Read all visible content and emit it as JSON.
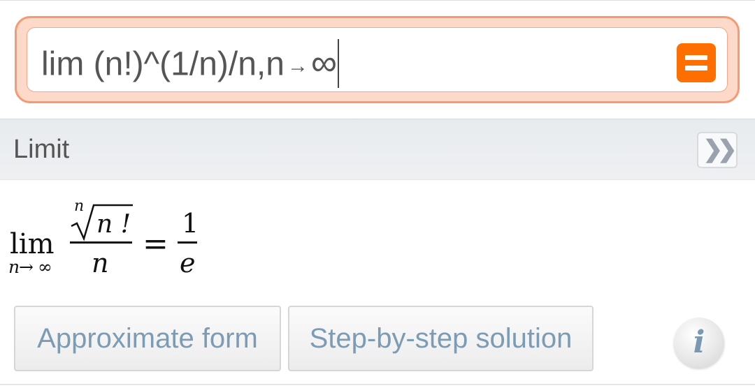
{
  "query": {
    "text": "lim (n!)^(1/n)/n,n",
    "arrow": "→",
    "tail": "∞"
  },
  "pod": {
    "title": "Limit",
    "more_glyph": "❯❯"
  },
  "result": {
    "lim": "lim",
    "sub_var": "n",
    "sub_arrow": "→",
    "sub_inf": "∞",
    "root_index": "n",
    "numerator": "n !",
    "denominator": "n",
    "equals": "=",
    "rhs_num": "1",
    "rhs_den": "e"
  },
  "buttons": {
    "approximate": "Approximate form",
    "steps": "Step-by-step solution",
    "info": "i"
  },
  "colors": {
    "accent": "#ff6f00",
    "input_border": "#f59a72",
    "button_text": "#7b9cb4"
  }
}
